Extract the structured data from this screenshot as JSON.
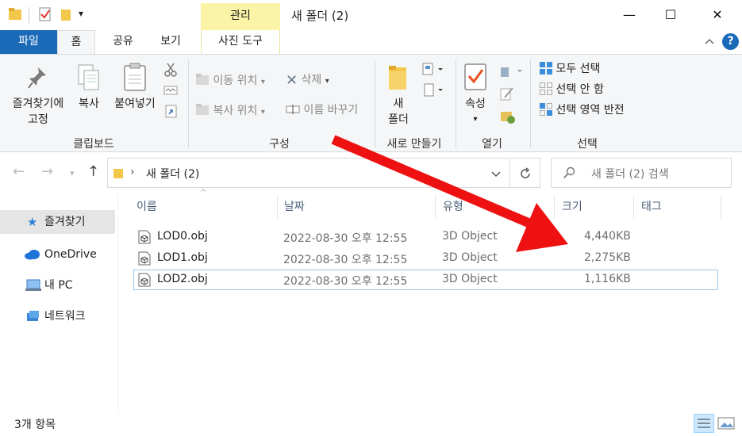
{
  "window": {
    "title": "새 폴더 (2)",
    "context_tab": "관리",
    "minimize": "—",
    "maximize": "☐",
    "close": "✕",
    "quick_access_dropdown": "▾"
  },
  "ribbon_tabs": {
    "file": "파일",
    "home": "홈",
    "share": "공유",
    "view": "보기",
    "picture_tools": "사진 도구",
    "help": "?"
  },
  "ribbon": {
    "pin_quick_line1": "즐겨찾기에",
    "pin_quick_line2": "고정",
    "copy": "복사",
    "paste": "붙여넣기",
    "clipboard_group": "클립보드",
    "move_to": "이동 위치",
    "copy_to": "복사 위치",
    "delete": "삭제",
    "rename": "이름 바꾸기",
    "organize_group": "구성",
    "new_folder_line1": "새",
    "new_folder_line2": "폴더",
    "new_group": "새로 만들기",
    "properties": "속성",
    "open_group": "열기",
    "select_all": "모두 선택",
    "select_none": "선택 안 함",
    "invert_selection": "선택 영역 반전",
    "select_group": "선택"
  },
  "address": {
    "crumb": "새 폴더 (2)",
    "search_placeholder": "새 폴더 (2) 검색"
  },
  "nav": {
    "quick_access": "즐겨찾기",
    "onedrive": "OneDrive",
    "this_pc": "내 PC",
    "network": "네트워크"
  },
  "columns": {
    "name": "이름",
    "date": "날짜",
    "type": "유형",
    "size": "크기",
    "tags": "태그"
  },
  "files": [
    {
      "name": "LOD0.obj",
      "date": "2022-08-30 오후 12:55",
      "type": "3D Object",
      "size": "4,440KB"
    },
    {
      "name": "LOD1.obj",
      "date": "2022-08-30 오후 12:55",
      "type": "3D Object",
      "size": "2,275KB"
    },
    {
      "name": "LOD2.obj",
      "date": "2022-08-30 오후 12:55",
      "type": "3D Object",
      "size": "1,116KB"
    }
  ],
  "status": {
    "item_count": "3개 항목"
  },
  "colors": {
    "file_tab": "#1a6ab8",
    "context_tab": "#fbf4a6",
    "annotation_arrow": "#ee1111",
    "folder": "#f3c74a"
  }
}
